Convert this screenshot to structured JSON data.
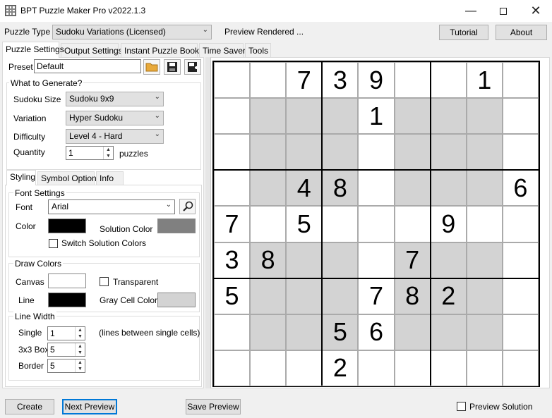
{
  "window": {
    "title": "BPT Puzzle Maker Pro v2022.1.3"
  },
  "toolbar": {
    "puzzle_type_label": "Puzzle Type",
    "puzzle_type_value": "Sudoku Variations (Licensed)",
    "status": "Preview Rendered ...",
    "tutorial": "Tutorial",
    "about": "About"
  },
  "tabs": [
    "Puzzle Settings",
    "Output Settings",
    "Instant Puzzle Books",
    "Time Saver",
    "Tools"
  ],
  "preset": {
    "label": "Preset",
    "value": "Default"
  },
  "generate": {
    "title": "What to Generate?",
    "size_label": "Sudoku Size",
    "size_value": "Sudoku  9x9",
    "variation_label": "Variation",
    "variation_value": "Hyper Sudoku",
    "difficulty_label": "Difficulty",
    "difficulty_value": "Level 4 - Hard",
    "quantity_label": "Quantity",
    "quantity_value": "1",
    "quantity_unit": "puzzles"
  },
  "subtabs": [
    "Styling",
    "Symbol Options",
    "Info"
  ],
  "font_settings": {
    "title": "Font Settings",
    "font_label": "Font",
    "font_value": "Arial",
    "color_label": "Color",
    "color": "#000000",
    "solution_color_label": "Solution Color",
    "solution_color": "#808080",
    "switch_label": "Switch Solution Colors"
  },
  "draw_colors": {
    "title": "Draw Colors",
    "canvas_label": "Canvas",
    "canvas_color": "#ffffff",
    "transparent_label": "Transparent",
    "line_label": "Line",
    "line_color": "#000000",
    "gray_label": "Gray Cell Color",
    "gray_color": "#d3d3d3"
  },
  "line_width": {
    "title": "Line Width",
    "single_label": "Single",
    "single_value": "1",
    "single_note": "(lines between single cells)",
    "box_label": "3x3 Box",
    "box_value": "5",
    "border_label": "Border",
    "border_value": "5"
  },
  "bottom": {
    "create": "Create",
    "next_preview": "Next Preview",
    "save_preview": "Save Preview",
    "preview_solution": "Preview Solution"
  },
  "sudoku": {
    "grid": [
      [
        "",
        "",
        "7",
        "3",
        "9",
        "",
        "",
        "1",
        ""
      ],
      [
        "",
        "",
        "",
        "",
        "1",
        "",
        "",
        "",
        ""
      ],
      [
        "",
        "",
        "",
        "",
        "",
        "",
        "",
        "",
        ""
      ],
      [
        "",
        "",
        "4",
        "8",
        "",
        "",
        "",
        "",
        "6"
      ],
      [
        "7",
        "",
        "5",
        "",
        "",
        "",
        "9",
        "",
        ""
      ],
      [
        "3",
        "8",
        "",
        "",
        "",
        "7",
        "",
        "",
        ""
      ],
      [
        "5",
        "",
        "",
        "",
        "7",
        "8",
        "2",
        "",
        ""
      ],
      [
        "",
        "",
        "",
        "5",
        "6",
        "",
        "",
        "",
        ""
      ],
      [
        "",
        "",
        "",
        "2",
        "",
        "",
        "",
        "",
        ""
      ]
    ],
    "gray_cells": [
      [
        1,
        1
      ],
      [
        1,
        2
      ],
      [
        1,
        3
      ],
      [
        2,
        1
      ],
      [
        2,
        2
      ],
      [
        2,
        3
      ],
      [
        3,
        1
      ],
      [
        3,
        2
      ],
      [
        3,
        3
      ],
      [
        1,
        5
      ],
      [
        1,
        6
      ],
      [
        1,
        7
      ],
      [
        2,
        5
      ],
      [
        2,
        6
      ],
      [
        2,
        7
      ],
      [
        3,
        5
      ],
      [
        3,
        6
      ],
      [
        3,
        7
      ],
      [
        5,
        1
      ],
      [
        5,
        2
      ],
      [
        5,
        3
      ],
      [
        6,
        1
      ],
      [
        6,
        2
      ],
      [
        6,
        3
      ],
      [
        7,
        1
      ],
      [
        7,
        2
      ],
      [
        7,
        3
      ],
      [
        5,
        5
      ],
      [
        5,
        6
      ],
      [
        5,
        7
      ],
      [
        6,
        5
      ],
      [
        6,
        6
      ],
      [
        6,
        7
      ],
      [
        7,
        5
      ],
      [
        7,
        6
      ],
      [
        7,
        7
      ]
    ]
  }
}
